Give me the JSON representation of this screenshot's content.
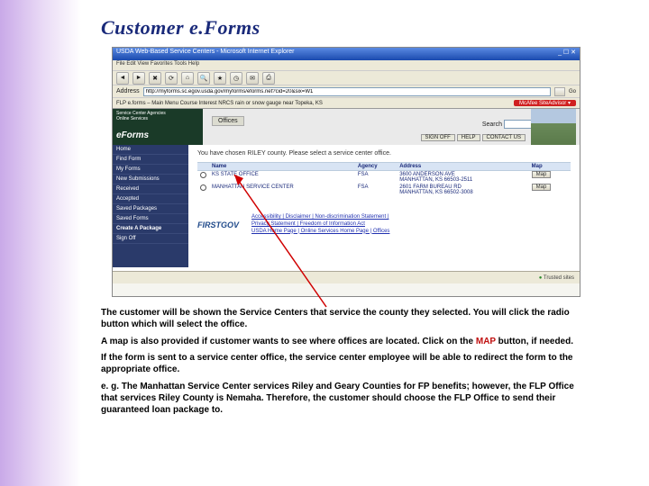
{
  "slide": {
    "title": "Customer e.Forms"
  },
  "browser": {
    "window_title": "USDA Web-Based Service Centers - Microsoft Internet Explorer",
    "menubar": "File  Edit  View  Favorites  Tools  Help",
    "address_label": "Address",
    "address_value": "http://myforms.sc.egov.usda.gov/myforms/eforms.net?cid=20&six=W1",
    "links_text": "FLP e.forms – Main Menu   Course Interest   NRCS rain or snow gauge near Topeka, KS",
    "mcafee_text": "McAfee SiteAdvisor ▾",
    "go_label": "Go"
  },
  "app": {
    "brand_top": "Service Center Agencies",
    "brand_sub": "Online Services",
    "brand_eforms": "eForms",
    "tab_label": "Offices",
    "search_label": "Search",
    "btn_signoff": "SIGN OFF",
    "btn_help": "HELP",
    "btn_contact": "CONTACT US",
    "intro_text": "You have chosen RILEY county. Please select a service center office.",
    "table_headers": {
      "name": "Name",
      "agency": "Agency",
      "address": "Address",
      "map": "Map"
    },
    "rows": [
      {
        "name": "KS STATE OFFICE",
        "agency": "FSA",
        "address": "3600 ANDERSON AVE\nMANHATTAN, KS 66503-2511",
        "map": "Map"
      },
      {
        "name": "MANHATTAN SERVICE CENTER",
        "agency": "FSA",
        "address": "2601 FARM BUREAU RD\nMANHATTAN, KS 66502-3008",
        "map": "Map"
      }
    ],
    "sidebar_items": [
      "Home",
      "Find Form",
      "My Forms",
      "New Submissions",
      "Received",
      "Accepted",
      "Saved Packages",
      "Saved Forms",
      "Create A Package",
      "Sign Off"
    ],
    "firstgov": "FIRSTGOV",
    "footer_links_line1": "Accessibility | Disclaimer | Non-discrimination Statement |",
    "footer_links_line2": "Privacy Statement | Freedom of Information Act",
    "footer_links_line3": "USDA Home Page | Online Services Home Page | Offices",
    "status_left": "",
    "status_right": "Trusted sites"
  },
  "body": {
    "p1": "The customer will be shown the Service Centers that service the county they selected. You will click the radio button which will select the office.",
    "p2a": "A map is also provided if customer wants to see where offices are located.  Click on the ",
    "p2_map": "MAP",
    "p2b": " button, if needed.",
    "p3": "If the form is sent to a service center office, the service center employee will be able to redirect the form to the appropriate office.",
    "p4": "e. g. The Manhattan Service Center services Riley and Geary Counties for FP benefits; however, the FLP Office that services Riley County is Nemaha.  Therefore, the customer should choose the FLP Office to send their guaranteed loan package to."
  }
}
